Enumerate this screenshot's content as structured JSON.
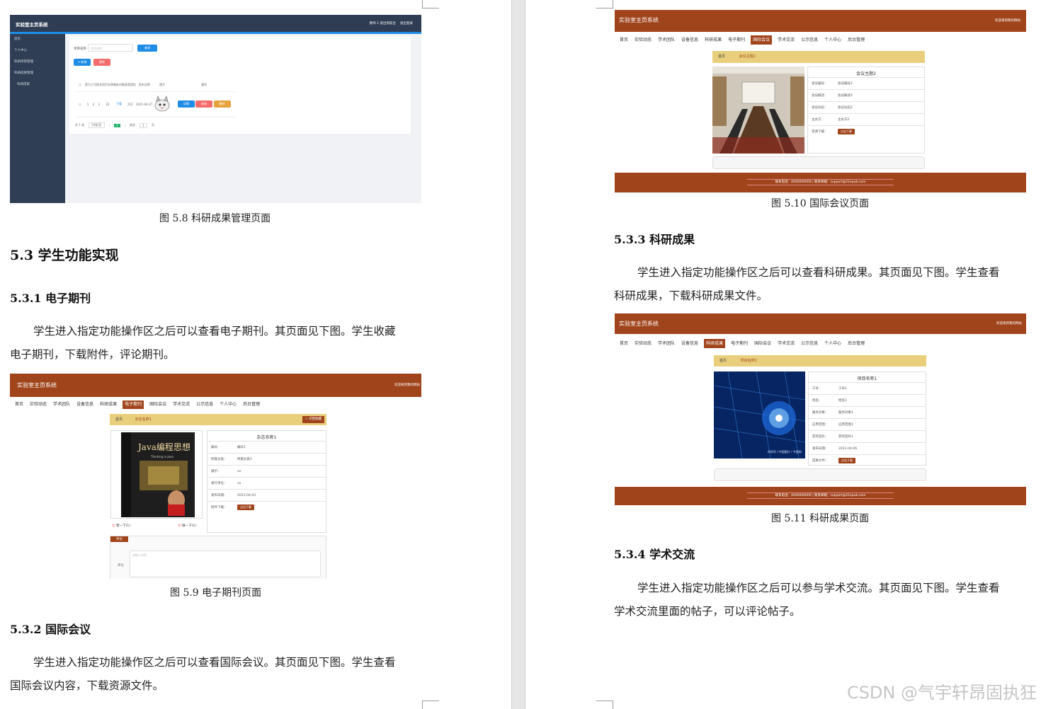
{
  "left": {
    "fig58": {
      "caption": "图 5.8  科研成果管理页面",
      "app_title": "实验室主页系统",
      "top_links": [
        "教师 2",
        "退出到前台",
        "退出登录"
      ],
      "sidebar": [
        "首页",
        "个人中心",
        "科研项目管理",
        "科研成果管理",
        "科研成果"
      ],
      "breadcrumb": [
        "首页",
        "科研成果"
      ],
      "search_label": "项目名称",
      "search_placeholder": "项目名称",
      "search_button": "查询",
      "add_button": "+ 新增",
      "delete_button": "删除",
      "columns": [
        "索引",
        "工号",
        "姓名",
        "项目名称",
        "服务对象",
        "获奖团队",
        "发布日期",
        "图片",
        "操作"
      ],
      "row": [
        "1",
        "2",
        "2",
        "22",
        "下载",
        "222",
        "2021-04-27"
      ],
      "row_actions": [
        "详情",
        "修改",
        "删除"
      ],
      "pager": [
        "共 1 条",
        "10条/页",
        "1",
        "前往",
        "1",
        "页"
      ]
    },
    "h53": "5.3  学生功能实现",
    "h531": "5.3.1  电子期刊",
    "p531": [
      "学生进入指定功能操作区之后可以查看电子期刊。其页面见下图。学生收藏",
      "电子期刊，下载附件，评论期刊。"
    ],
    "fig59": {
      "caption": "图 5.9  电子期刊页面",
      "site_title": "实验室主页系统",
      "welcome": "欢迎来到我的网站",
      "nav": [
        "首页",
        "实验动态",
        "学术团队",
        "设备信息",
        "科研成果",
        "电子期刊",
        "国际会议",
        "学术交流",
        "公示信息",
        "个人中心",
        "后台管理"
      ],
      "active_nav": "电子期刊",
      "crumb": [
        "首页",
        "杂志名称1"
      ],
      "fav_button": "点我收藏",
      "info_title": "杂志名称1",
      "fields": [
        [
          "编号：",
          "编号1"
        ],
        [
          "所属分类：",
          "所属分类1"
        ],
        [
          "展示：",
          "xx"
        ],
        [
          "发行单位：",
          "xx"
        ],
        [
          "发布日期：",
          "2021-04-03"
        ],
        [
          "附件下载：",
          "点击下载"
        ]
      ],
      "vote": [
        "赞一下(1)",
        "踩一下(1)"
      ],
      "comment_tab": "评论",
      "comment_label": "评论",
      "comment_placeholder": "请输入内容",
      "book_title": "Java编程思想",
      "book_sub": "Thinking in Java"
    },
    "h532": "5.3.2  国际会议",
    "p532": [
      "学生进入指定功能操作区之后可以查看国际会议。其页面见下图。学生查看",
      "国际会议内容，下载资源文件。"
    ]
  },
  "right": {
    "fig510": {
      "caption": "图 5.10  国际会议页面",
      "site_title": "实验室主页系统",
      "welcome": "欢迎来到我的网站",
      "nav": [
        "首页",
        "实验动态",
        "学术团队",
        "设备信息",
        "科研成果",
        "电子期刊",
        "国际会议",
        "学术交流",
        "公示信息",
        "个人中心",
        "后台管理"
      ],
      "active_nav": "国际会议",
      "crumb": [
        "首页",
        "会议主题2"
      ],
      "info_title": "会议主题2",
      "fields": [
        [
          "会议编号：",
          "会议编号2"
        ],
        [
          "会议概述：",
          "会议概述2"
        ],
        [
          "会议动态：",
          "会议动态2"
        ],
        [
          "主办方：",
          "主办方2"
        ],
        [
          "资源下载：",
          "点击下载"
        ]
      ],
      "footer": "联系电话：4000000000 | 联系邮箱：support@21epub.com"
    },
    "h533": "5.3.3  科研成果",
    "p533": [
      "学生进入指定功能操作区之后可以查看科研成果。其页面见下图。学生查看",
      "科研成果，下载科研成果文件。"
    ],
    "fig511": {
      "caption": "图 5.11  科研成果页面",
      "site_title": "实验室主页系统",
      "welcome": "欢迎来到我的网站",
      "nav": [
        "首页",
        "实验动态",
        "学术团队",
        "设备信息",
        "科研成果",
        "电子期刊",
        "国际会议",
        "学术交流",
        "公示信息",
        "个人中心",
        "后台管理"
      ],
      "active_nav": "科研成果",
      "crumb": [
        "首页",
        "项目名称1"
      ],
      "info_title": "项目名称1",
      "fields": [
        [
          "工号：",
          "工号1"
        ],
        [
          "姓名：",
          "姓名1"
        ],
        [
          "服务对象：",
          "服务对象1"
        ],
        [
          "应用范围：",
          "应用范围1"
        ],
        [
          "获奖团队：",
          "获奖团队1"
        ],
        [
          "发布日期：",
          "2021-04-06"
        ],
        [
          "成果文件：",
          "点击下载"
        ]
      ],
      "image_text": "时间号 / 中国图片 / 今图网",
      "footer": "联系电话：4000000000 | 联系邮箱：support@21epub.com"
    },
    "h534": "5.3.4  学术交流",
    "p534": [
      "学生进入指定功能操作区之后可以参与学术交流。其页面见下图。学生查看",
      "学术交流里面的帖子，可以评论帖子。"
    ]
  },
  "watermark": "CSDN @气宇轩昂固执狂"
}
